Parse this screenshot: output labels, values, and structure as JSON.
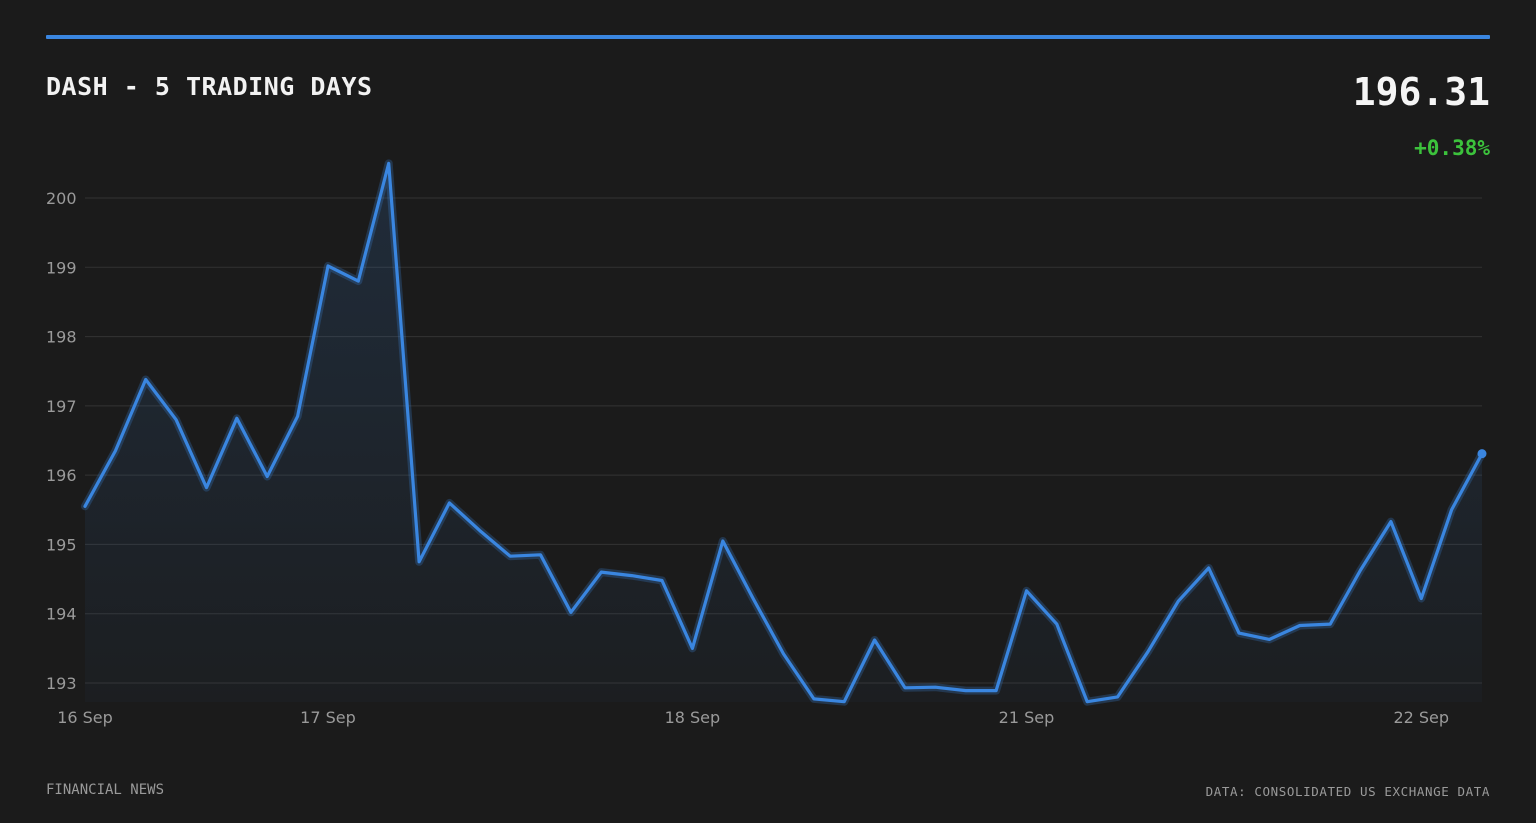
{
  "header": {
    "title": "DASH - 5 TRADING DAYS",
    "price": "196.31",
    "change": "+0.38%"
  },
  "footer": {
    "left": "FINANCIAL NEWS",
    "right": "DATA: CONSOLIDATED US EXCHANGE DATA"
  },
  "colors": {
    "accent": "#3a86e0",
    "positive": "#3cc23c",
    "background": "#1b1b1b",
    "grid": "#333333",
    "tick_text": "#9a9a9a"
  },
  "chart_data": {
    "type": "area",
    "title": "DASH - 5 TRADING DAYS",
    "xlabel": "",
    "ylabel": "",
    "ylim": [
      192.7,
      200.5
    ],
    "yticks": [
      193,
      194,
      195,
      196,
      197,
      198,
      199,
      200
    ],
    "grid": true,
    "x_tick_labels": [
      {
        "index": 0,
        "label": "16 Sep"
      },
      {
        "index": 8,
        "label": "17 Sep"
      },
      {
        "index": 20,
        "label": "18 Sep"
      },
      {
        "index": 31,
        "label": "21 Sep"
      },
      {
        "index": 44,
        "label": "22 Sep"
      }
    ],
    "series": [
      {
        "values": [
          195.55,
          196.35,
          197.38,
          196.8,
          195.82,
          196.82,
          195.98,
          196.85,
          199.02,
          198.8,
          200.5,
          194.75,
          195.6,
          195.2,
          194.83,
          194.85,
          194.02,
          194.6,
          194.55,
          194.48,
          193.5,
          195.05,
          194.22,
          193.42,
          192.77,
          192.73,
          193.62,
          192.93,
          192.94,
          192.89,
          192.89,
          194.33,
          193.85,
          192.73,
          192.8,
          193.45,
          194.18,
          194.66,
          193.72,
          193.63,
          193.83,
          193.85,
          194.63,
          195.33,
          194.22,
          195.5,
          196.31
        ]
      }
    ]
  }
}
